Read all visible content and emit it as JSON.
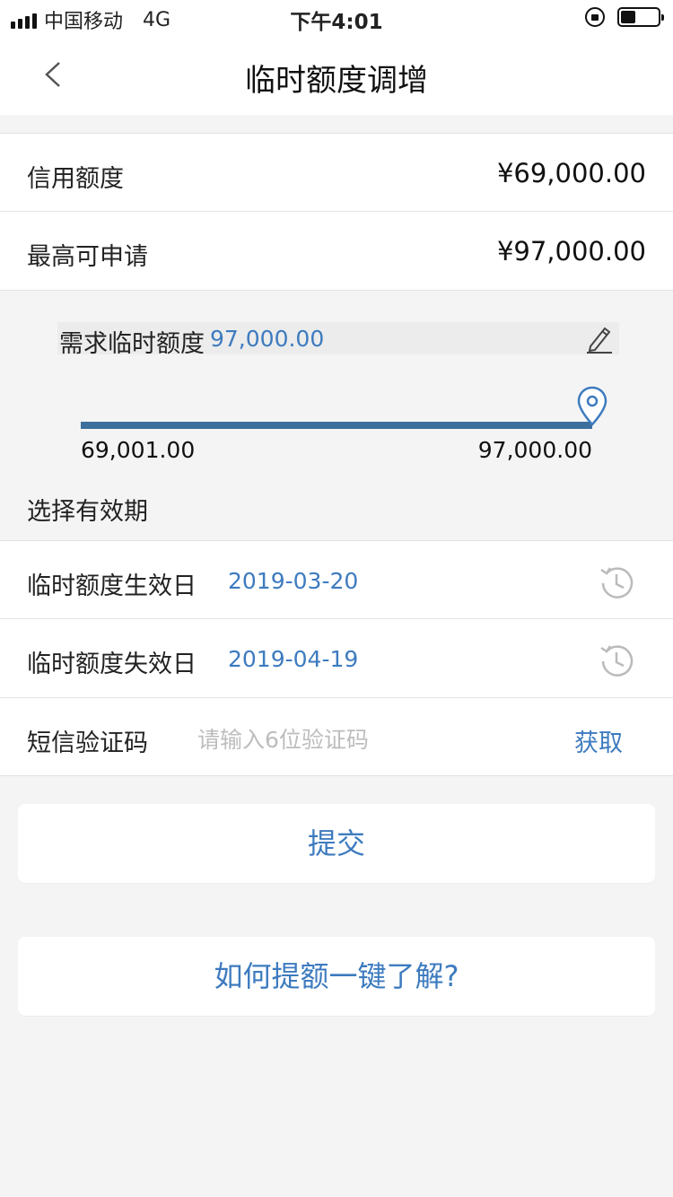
{
  "status_bar": {
    "carrier": "中国移动",
    "network": "4G",
    "time": "下午4:01"
  },
  "nav": {
    "title": "临时额度调增"
  },
  "credit_limit": {
    "label": "信用额度",
    "value": "¥69,000.00"
  },
  "max_apply": {
    "label": "最高可申请",
    "value": "¥97,000.00"
  },
  "demand": {
    "label": "需求临时额度",
    "value": "97,000.00"
  },
  "slider": {
    "min_label": "69,001.00",
    "max_label": "97,000.00",
    "fraction": 1.0
  },
  "validity": {
    "title": "选择有效期",
    "start": {
      "label": "临时额度生效日",
      "value": "2019-03-20"
    },
    "end": {
      "label": "临时额度失效日",
      "value": "2019-04-19"
    }
  },
  "sms": {
    "label": "短信验证码",
    "placeholder": "请输入6位验证码",
    "get_label": "获取"
  },
  "buttons": {
    "submit": "提交",
    "learn_more": "如何提额一键了解?"
  },
  "colors": {
    "accent": "#3d7bbf",
    "slider": "#3c6f9c"
  }
}
